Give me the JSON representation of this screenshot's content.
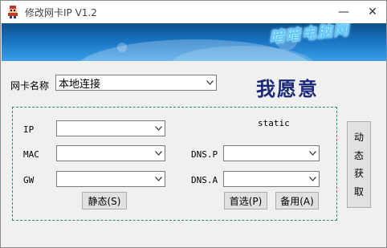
{
  "window": {
    "title": "修改网卡IP V1.2",
    "minimize_glyph": "—",
    "close_glyph": "✕"
  },
  "banner": {
    "brand_text": "暗暗电脑网"
  },
  "adapter": {
    "label": "网卡名称",
    "selected": "本地连接"
  },
  "slogan": "我愿意",
  "form": {
    "mode_label": "static",
    "ip_label": "IP",
    "ip_value": "",
    "mac_label": "MAC",
    "mac_value": "",
    "gw_label": "GW",
    "gw_value": "",
    "dns_p_label": "DNS.P",
    "dns_p_value": "",
    "dns_a_label": "DNS.A",
    "dns_a_value": "",
    "static_button": "静态(S)",
    "primary_button": "首选(P)",
    "backup_button": "备用(A)"
  },
  "dynamic_button": {
    "chars": [
      "动",
      "态",
      "获",
      "取"
    ]
  },
  "colors": {
    "banner_top": "#0b4e8a",
    "banner_bottom": "#3aa0e8",
    "group_border": "#1e8a7a",
    "slogan": "#1a2a7a"
  }
}
